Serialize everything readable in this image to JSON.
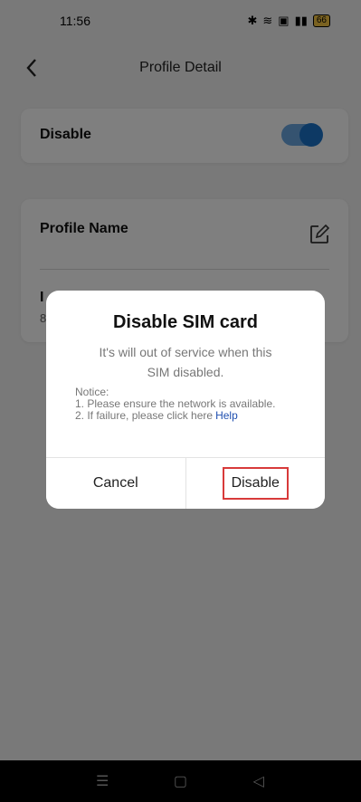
{
  "status_bar": {
    "time": "11:56",
    "icons_text": "✱ ≈ ▣ ⋮▐",
    "battery": "66"
  },
  "header": {
    "title": "Profile Detail",
    "back_icon": "chevron-left-icon"
  },
  "disable_card": {
    "label": "Disable",
    "toggle_on": true,
    "toggle_color": "#1a73c9"
  },
  "profile_card": {
    "profile_name_label": "Profile Name",
    "second_label": "I",
    "second_value": "8"
  },
  "dialog": {
    "title": "Disable SIM card",
    "message_line1": "It's will out of service when this",
    "message_line2": "SIM disabled.",
    "notice_title": "Notice:",
    "notice_1": "1. Please ensure the network is available.",
    "notice_2": "2. If failure, please click here",
    "help_link": "Help",
    "cancel_label": "Cancel",
    "disable_label": "Disable",
    "highlight_color": "#d83a3a"
  },
  "nav_bar": {
    "menu_icon": "☰",
    "home_icon": "▢",
    "back_icon": "◁"
  }
}
